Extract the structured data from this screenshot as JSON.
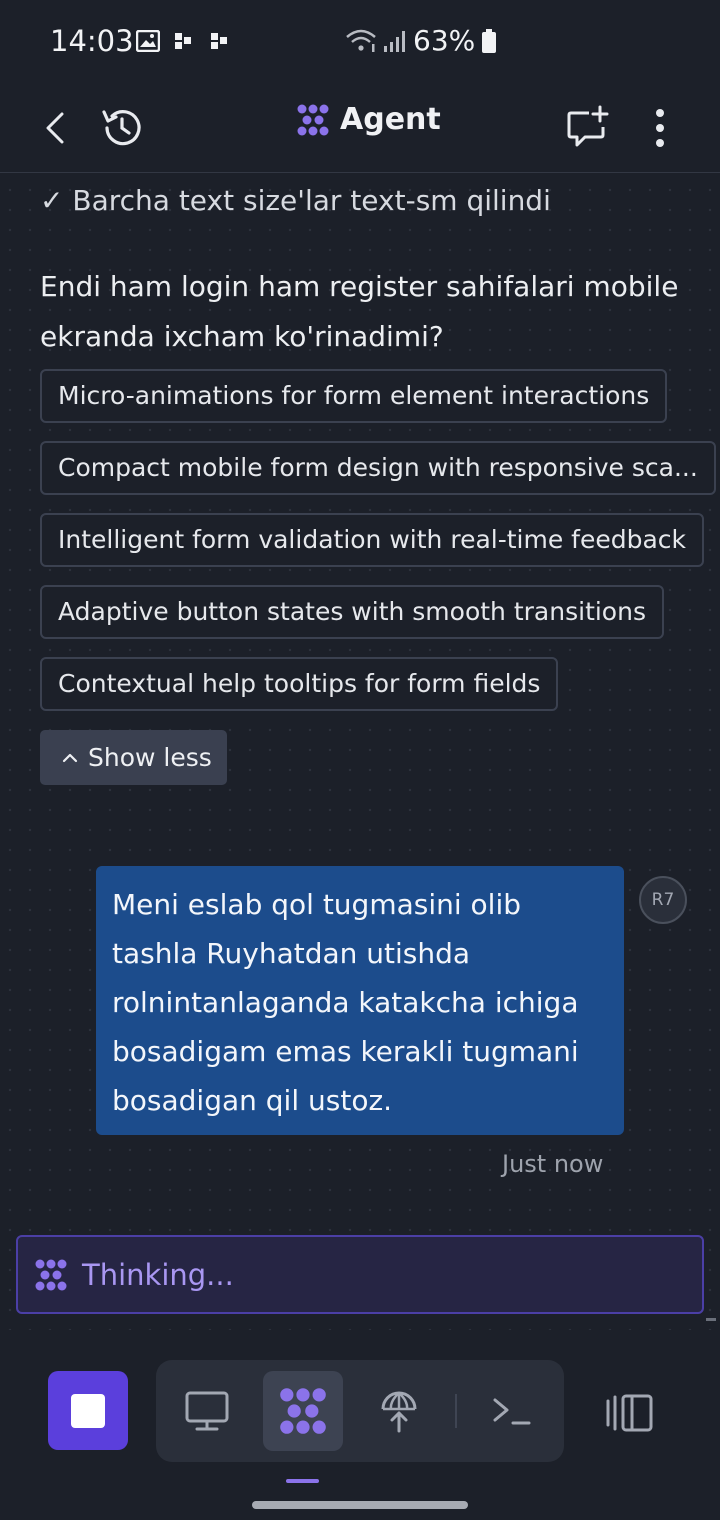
{
  "status_bar": {
    "time": "14:03",
    "battery": "63%"
  },
  "header": {
    "title": "Agent"
  },
  "chat": {
    "check_line": "✓ Barcha text size'lar text-sm qilindi",
    "question": "Endi ham login ham register sahifalari mobile ekranda ixcham ko'rinadimi?",
    "suggestions": [
      "Micro-animations for form element interactions",
      "Compact mobile form design with responsive sca...",
      "Intelligent form validation with real-time feedback",
      "Adaptive button states with smooth transitions",
      "Contextual help tooltips for form fields"
    ],
    "show_less": "Show less",
    "user_message": "Meni eslab qol tugmasini olib tashla Ruyhatdan utishda rolnintanlaganda katakcha ichiga bosadigam emas kerakli tugmani bosadigan qil ustoz.",
    "avatar": "R7",
    "timestamp": "Just now"
  },
  "thinking": {
    "label": "Thinking..."
  },
  "colors": {
    "accent": "#5b3fdc",
    "bubble": "#1c4c8c",
    "thinking_text": "#a997f2",
    "background": "#1c2029"
  },
  "icons": [
    "back-icon",
    "history-icon",
    "agent-logo-icon",
    "new-chat-icon",
    "more-vert-icon",
    "stop-icon",
    "desktop-icon",
    "agent-icon",
    "deploy-icon",
    "terminal-icon",
    "split-panel-icon"
  ]
}
